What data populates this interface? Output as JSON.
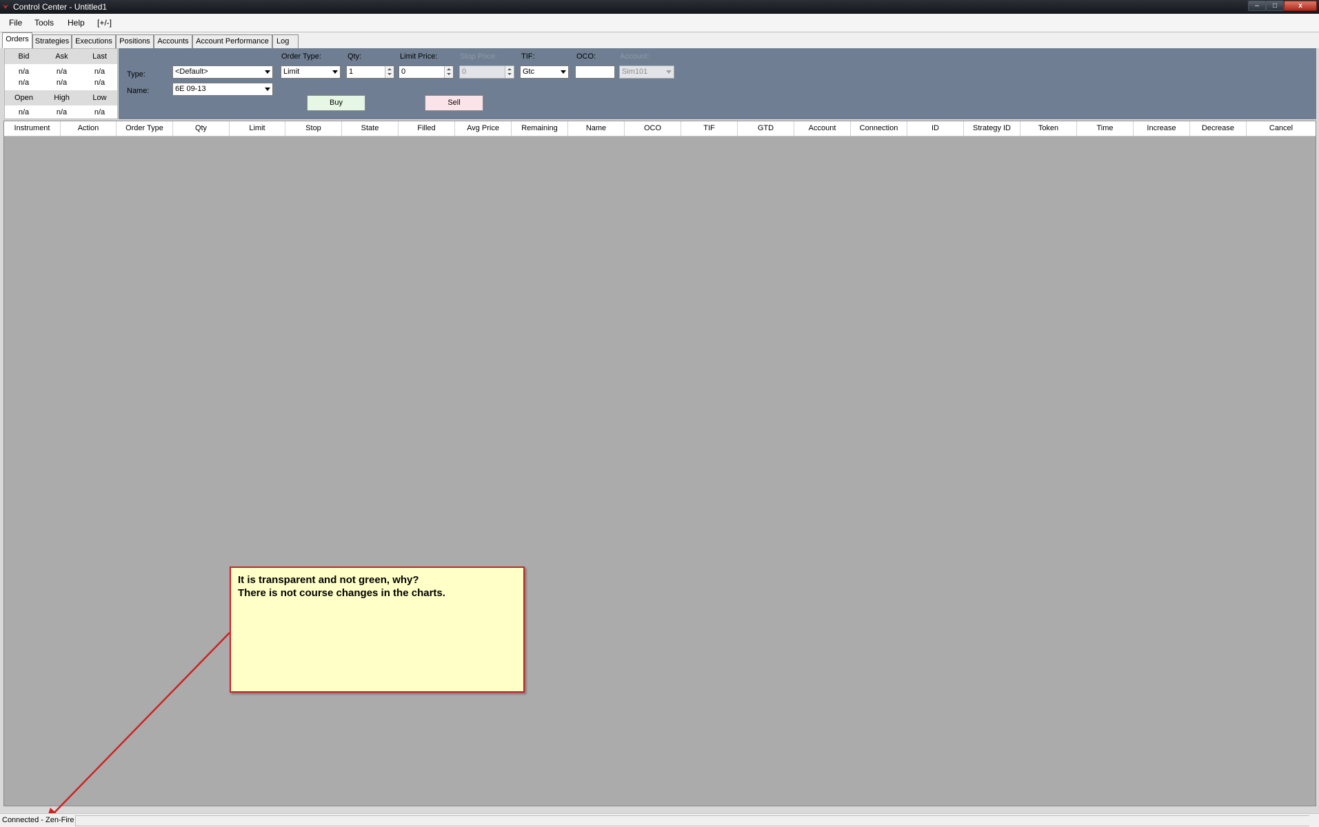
{
  "window": {
    "title": "Control Center - Untitled1",
    "minimize": "–",
    "maximize": "□",
    "close": "x"
  },
  "menu": [
    "File",
    "Tools",
    "Help",
    "[+/-]"
  ],
  "tabs": [
    "Orders",
    "Strategies",
    "Executions",
    "Positions",
    "Accounts",
    "Account Performance",
    "Log"
  ],
  "quote": {
    "headers1": [
      "Bid",
      "Ask",
      "Last"
    ],
    "row1": [
      "n/a",
      "n/a",
      "n/a"
    ],
    "row2": [
      "n/a",
      "n/a",
      "n/a"
    ],
    "headers2": [
      "Open",
      "High",
      "Low"
    ],
    "row3": [
      "n/a",
      "n/a",
      "n/a"
    ]
  },
  "entry": {
    "type_label": "Type:",
    "type_value": "<Default>",
    "name_label": "Name:",
    "name_value": "6E 09-13",
    "order_type_label": "Order Type:",
    "order_type_value": "Limit",
    "qty_label": "Qty:",
    "qty_value": "1",
    "limit_price_label": "Limit Price:",
    "limit_price_value": "0",
    "stop_price_label": "Stop Price:",
    "stop_price_value": "0",
    "tif_label": "TIF:",
    "tif_value": "Gtc",
    "oco_label": "OCO:",
    "oco_value": "",
    "account_label": "Account:",
    "account_value": "Sim101",
    "buy": "Buy",
    "sell": "Sell"
  },
  "grid": {
    "columns": [
      "Instrument",
      "Action",
      "Order Type",
      "Qty",
      "Limit",
      "Stop",
      "State",
      "Filled",
      "Avg Price",
      "Remaining",
      "Name",
      "OCO",
      "TIF",
      "GTD",
      "Account",
      "Connection",
      "ID",
      "Strategy ID",
      "Token",
      "Time",
      "Increase",
      "Decrease",
      "Cancel"
    ],
    "rows": []
  },
  "annotation": {
    "line1": "It is transparent and not green, why?",
    "line2": "There is not course changes in the charts.",
    "border_color": "#cc2222",
    "fill_color": "#ffffc8"
  },
  "status": {
    "text": "Connected - Zen-Fire"
  }
}
